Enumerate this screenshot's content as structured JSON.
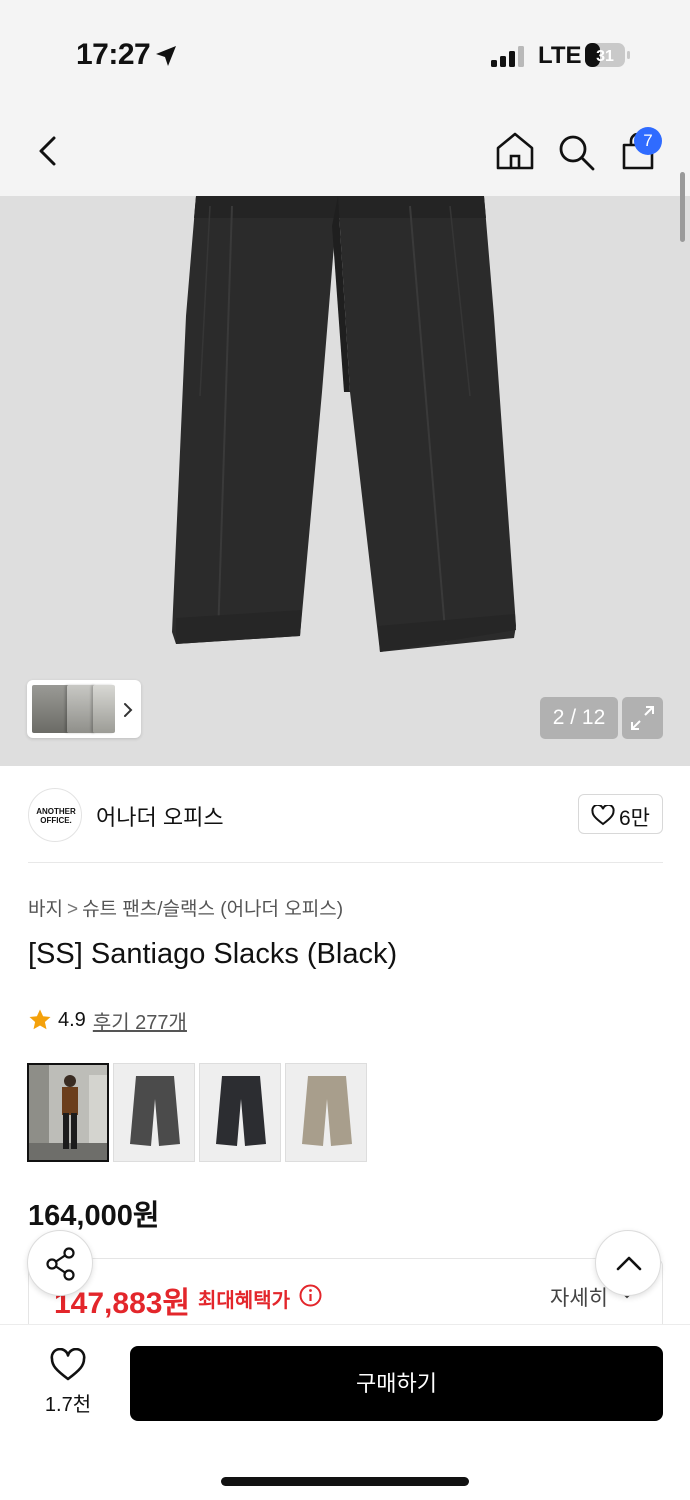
{
  "status_bar": {
    "time": "17:27",
    "network": "LTE",
    "battery": "31"
  },
  "nav": {
    "cart_count": "7",
    "icons": [
      "back-icon",
      "home-icon",
      "search-icon",
      "shopping-bag-icon"
    ]
  },
  "gallery": {
    "counter": "2 / 12",
    "current_index": 2,
    "total": 12
  },
  "brand": {
    "logo_text_1": "ANOTHER",
    "logo_text_2": "OFFICE.",
    "name": "어나더 오피스",
    "likes": "6만"
  },
  "breadcrumb": {
    "items": [
      "바지",
      "슈트 팬츠/슬랙스 (어나더 오피스)"
    ],
    "separator": ">"
  },
  "product": {
    "title": "[SS] Santiago Slacks (Black)",
    "rating": "4.9",
    "reviews": "후기 277개",
    "variants": [
      "model-photo",
      "charcoal",
      "black",
      "beige"
    ],
    "price": "164,000원",
    "benefit_price": "147,883원",
    "benefit_label": "최대혜택가",
    "benefit_detail": "자세히"
  },
  "bottom_bar": {
    "like_count": "1.7천",
    "buy_label": "구매하기"
  },
  "colors": {
    "accent_red": "#e3262b",
    "badge_blue": "#2f6bff",
    "button_black": "#000000"
  }
}
